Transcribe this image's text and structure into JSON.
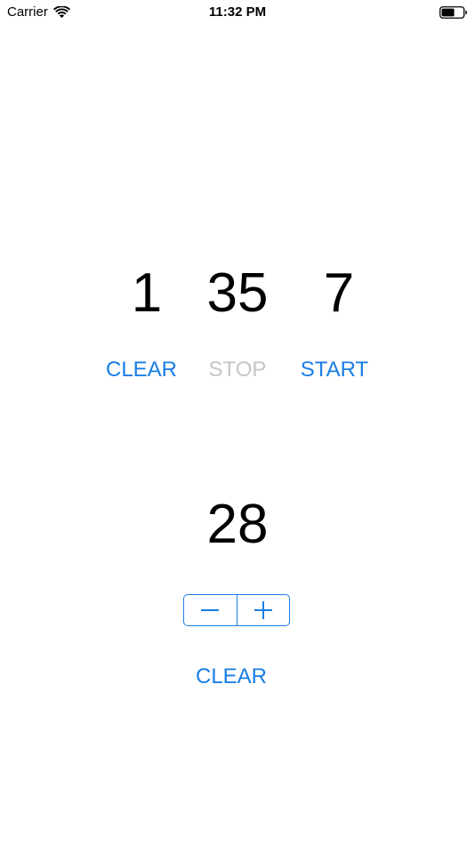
{
  "status_bar": {
    "carrier": "Carrier",
    "time": "11:32 PM",
    "icons": [
      "wifi-icon",
      "battery-icon"
    ]
  },
  "timer": {
    "values": [
      "1",
      "35",
      "7"
    ],
    "buttons": {
      "clear": "CLEAR",
      "stop": "STOP",
      "start": "START"
    },
    "stop_enabled": false
  },
  "counter": {
    "value": "28",
    "stepper": {
      "decrement_icon": "minus-icon",
      "increment_icon": "plus-icon"
    },
    "clear_label": "CLEAR"
  },
  "colors": {
    "accent": "#1a7de6",
    "disabled": "#c6c6c9",
    "text": "#000000",
    "background": "#ffffff"
  }
}
